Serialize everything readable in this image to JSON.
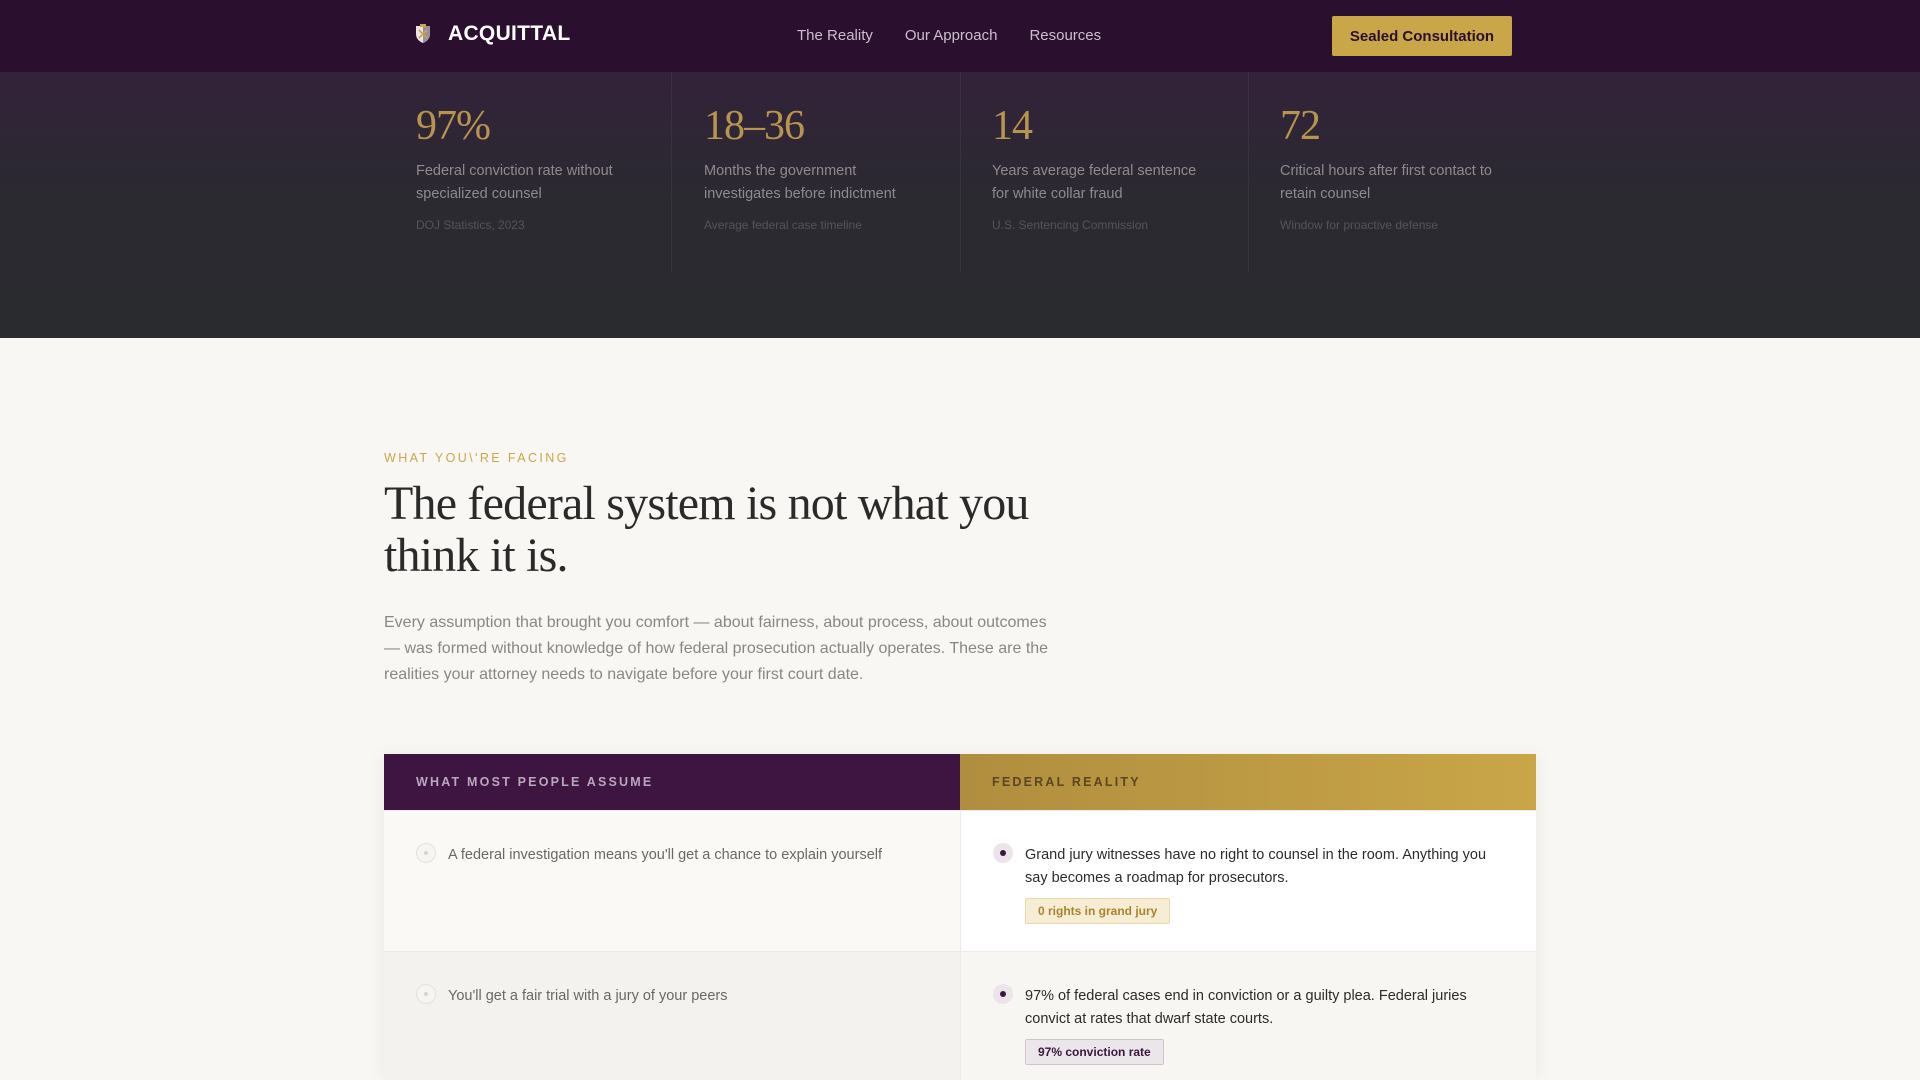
{
  "nav": {
    "brand": "ACQUITTAL",
    "links": [
      "The Reality",
      "Our Approach",
      "Resources"
    ],
    "cta_label": "Sealed Consultation"
  },
  "stats": [
    {
      "value": "97%",
      "description": "Federal conviction rate without specialized counsel",
      "source": "DOJ Statistics, 2023"
    },
    {
      "value": "18–36",
      "description": "Months the government investigates before indictment",
      "source": "Average federal case timeline"
    },
    {
      "value": "14",
      "description": "Years average federal sentence for white collar fraud",
      "source": "U.S. Sentencing Commission"
    },
    {
      "value": "72",
      "description": "Critical hours after first contact to retain counsel",
      "source": "Window for proactive defense"
    }
  ],
  "section": {
    "eyebrow": "WHAT YOU\\'RE FACING",
    "headline": "The federal system is not what you think it is.",
    "lede": "Every assumption that brought you comfort — about fairness, about process, about outcomes — was formed without knowledge of how federal prosecution actually operates. These are the realities your attorney needs to navigate before your first court date."
  },
  "comparison": {
    "header_left": "WHAT MOST PEOPLE ASSUME",
    "header_right": "FEDERAL REALITY",
    "rows": [
      {
        "assumption": "A federal investigation means you'll get a chance to explain yourself",
        "reality": "Grand jury witnesses have no right to counsel in the room. Anything you say becomes a roadmap for prosecutors.",
        "badge": "0 rights in grand jury"
      },
      {
        "assumption": "You'll get a fair trial with a jury of your peers",
        "reality": "97% of federal cases end in conviction or a guilty plea. Federal juries convict at rates that dwarf state courts.",
        "badge": "97% conviction rate"
      }
    ]
  },
  "colors": {
    "nav_bg": "#2a0f2e",
    "accent_gold": "#c9a648",
    "plum": "#3d1540",
    "page_bg": "#f8f7f3"
  },
  "icons": {
    "brand": "shield-crest-icon"
  }
}
